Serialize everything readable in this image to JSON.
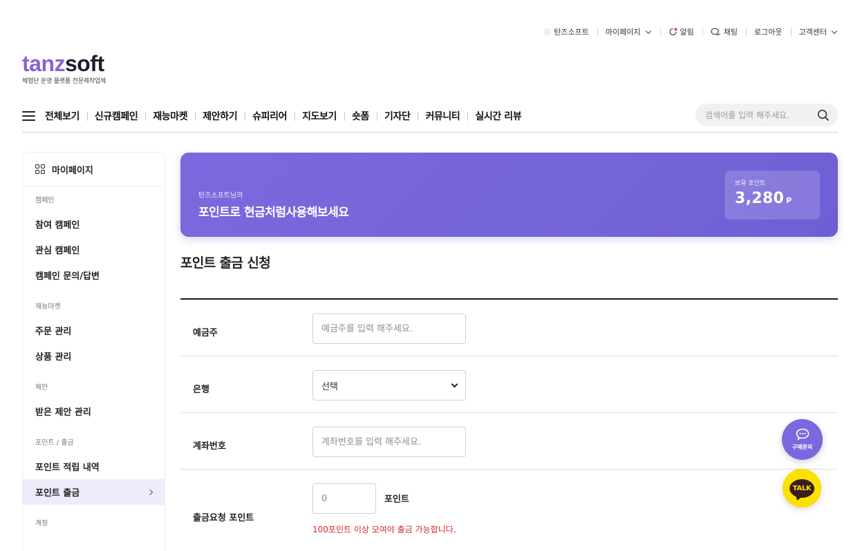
{
  "util_bar": {
    "items": [
      {
        "label": "탄즈소프트",
        "icon": "profile-dot-icon"
      },
      {
        "label": "마이페이지",
        "icon": "chevron-down-icon"
      },
      {
        "label": "알림",
        "icon": "bell-icon"
      },
      {
        "label": "채팅",
        "icon": "chat-icon"
      },
      {
        "label": "로그아웃"
      },
      {
        "label": "고객센터",
        "icon": "chevron-down-icon"
      }
    ]
  },
  "logo": {
    "part1": "tanz",
    "part2": "soft",
    "tagline": "체험단 운영 플랫폼 전문제작업체",
    "colors": {
      "tanz": "#8a63d2",
      "soft": "#1e1e2e"
    }
  },
  "gnb": {
    "items": [
      "전체보기",
      "신규캠페인",
      "재능마켓",
      "제안하기",
      "슈피리어",
      "지도보기",
      "숏폼",
      "기자단",
      "커뮤니티",
      "실시간 리뷰"
    ],
    "search_placeholder": "검색어를 입력 해주세요."
  },
  "sidebar": {
    "title": "마이페이지",
    "sections": [
      {
        "title": "캠페인",
        "links": [
          "참여 캠페인",
          "관심 캠페인",
          "캠페인 문의/답변"
        ]
      },
      {
        "title": "재능마켓",
        "links": [
          "주문 관리",
          "상품 관리"
        ]
      },
      {
        "title": "제안",
        "links": [
          "받은 제안 관리"
        ]
      },
      {
        "title": "포인트 / 출금",
        "links": [
          "포인트 적립 내역",
          "포인트 출금"
        ]
      },
      {
        "title": "계정",
        "links": []
      }
    ],
    "active": "포인트 출금"
  },
  "banner": {
    "subtitle": "탄즈소프트님의",
    "title": "포인트로 현금처럼사용해보세요",
    "points_label": "보유 포인트",
    "points_value": "3,280",
    "points_unit": "P",
    "color": "#7566d9"
  },
  "form": {
    "title": "포인트 출금 신청",
    "depositor_label": "예금주",
    "depositor_placeholder": "예금주를 입력 해주세요.",
    "bank_label": "은행",
    "bank_value": "선택",
    "account_label": "계좌번호",
    "account_placeholder": "계좌번호를 입력 해주세요.",
    "amount_label": "출금요청 포인트",
    "amount_placeholder": "0",
    "amount_unit": "포인트",
    "warning": "100포인트 이상 모여야 출금 가능합니다."
  },
  "floating": {
    "inquiry_label": "구매문의",
    "talk_label": "TALK",
    "colors": {
      "inquiry": "#7c68de",
      "talk": "#fae100"
    }
  }
}
